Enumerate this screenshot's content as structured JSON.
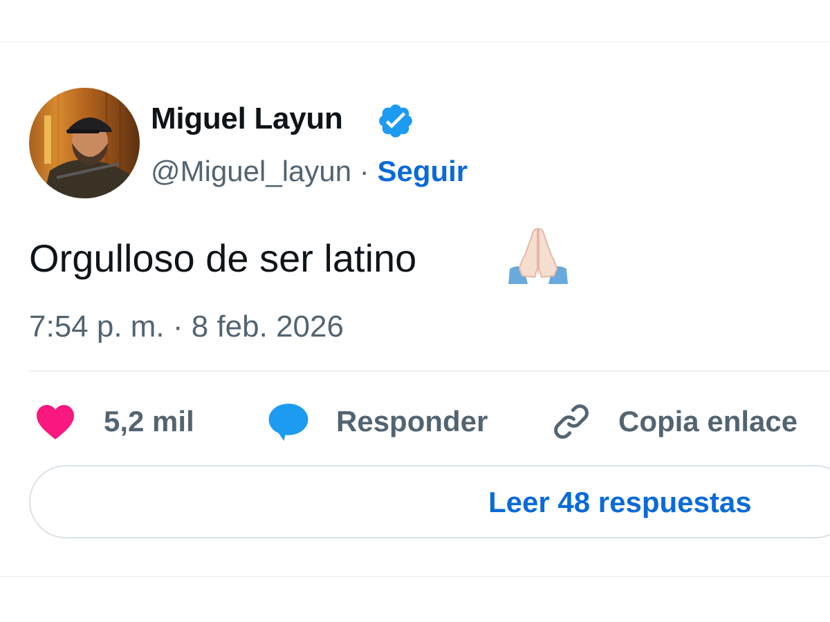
{
  "tweet": {
    "author": {
      "display_name": "Miguel Layun",
      "handle": "@Miguel_layun",
      "verified": true,
      "follow_label": "Seguir",
      "separator": " · "
    },
    "text": "Orgulloso de ser latino",
    "emoji": "folded-hands-emoji",
    "timestamp": "7:54 p. m. · 8 feb. 2026"
  },
  "actions": {
    "likes_count": "5,2 mil",
    "reply_label": "Responder",
    "copy_link_label": "Copia enlace"
  },
  "read_replies_label": "Leer 48 respuestas",
  "colors": {
    "accent": "#0a6ad8",
    "verified_badge": "#1d9bf0",
    "like_heart": "#f91880",
    "reply_bubble": "#1d9bf0",
    "secondary_text": "#536471",
    "primary_text": "#0f1419",
    "divider": "#e6ecf0"
  },
  "icons": {
    "like": "heart-icon",
    "reply": "speech-bubble-icon",
    "copy": "link-icon",
    "verified": "verified-badge-icon"
  }
}
